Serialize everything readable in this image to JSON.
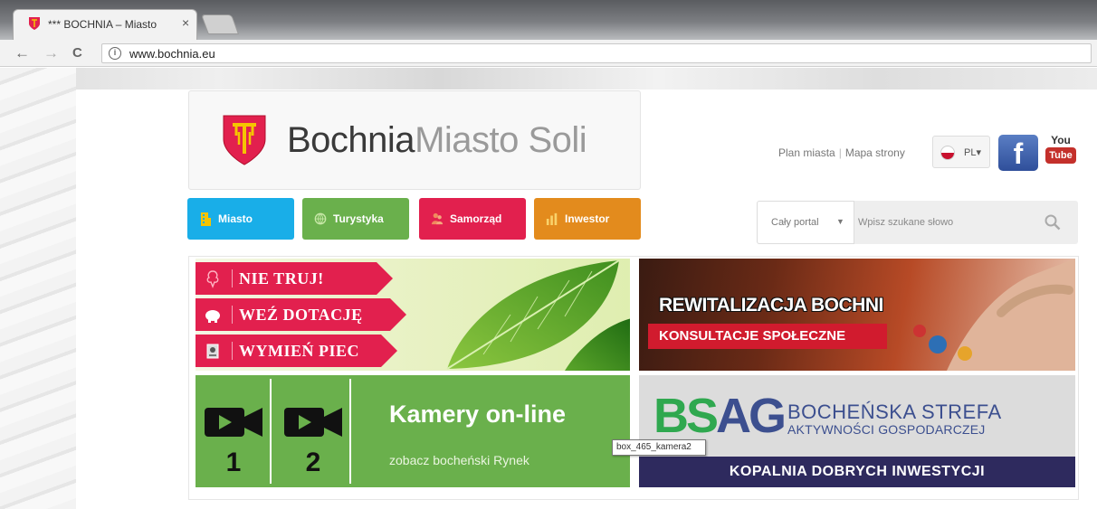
{
  "browser": {
    "tab_title": "*** BOCHNIA – Miasto Soli",
    "tab_close": "×",
    "url": "www.bochnia.eu",
    "info_icon": "ⓘ",
    "back": "←",
    "forward": "→",
    "reload": "C"
  },
  "header": {
    "brand_main": "Bochnia",
    "brand_sub": "Miasto Soli",
    "links": [
      "Plan miasta",
      "Mapa strony"
    ],
    "lang_code": "PL",
    "lang_caret": "▾",
    "facebook": "f",
    "youtube_top": "You",
    "youtube_bottom": "Tube"
  },
  "nav": [
    {
      "label": "Miasto",
      "color": "#19aee8",
      "icon": "building-icon"
    },
    {
      "label": "Turystyka",
      "color": "#6ab04c",
      "icon": "globe-icon"
    },
    {
      "label": "Samorząd",
      "color": "#e2204e",
      "icon": "people-icon"
    },
    {
      "label": "Inwestor",
      "color": "#e38b1d",
      "icon": "chart-icon"
    }
  ],
  "search": {
    "scope": "Cały portal",
    "caret": "▼",
    "placeholder": "Wpisz szukane słowo"
  },
  "banners": {
    "ecology": [
      "NIE TRUJ!",
      "WEŹ DOTACJĘ",
      "WYMIEŃ PIEC"
    ],
    "rewitalizacja_title": "REWITALIZACJA BOCHNI",
    "rewitalizacja_badge": "KONSULTACJE SPOŁECZNE",
    "cams": {
      "cam1": "1",
      "cam2": "2",
      "title": "Kamery on-line",
      "subtitle": "zobacz bocheński Rynek",
      "tooltip": "box_465_kamera2"
    },
    "bsag": {
      "logo_b": "B",
      "logo_s": "S",
      "logo_a": "A",
      "logo_g": "G",
      "line1": "BOCHEŃSKA STREFA",
      "line2": "AKTYWNOŚCI GOSPODARCZEJ",
      "bar": "KOPALNIA DOBRYCH INWESTYCJI"
    }
  },
  "colors": {
    "miasto": "#19aee8",
    "turystyka": "#6ab04c",
    "samorzad": "#e2204e",
    "inwestor": "#e38b1d",
    "bsag_green": "#2fa84f",
    "bsag_blue": "#3c4f8f"
  }
}
